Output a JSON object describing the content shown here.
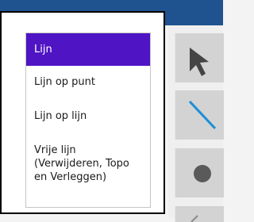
{
  "window": {
    "title_bar_color": "#1e5390"
  },
  "menu": {
    "items": [
      {
        "label": "Lijn",
        "selected": true
      },
      {
        "label": "Lijn op punt",
        "selected": false
      },
      {
        "label": "Lijn op lijn",
        "selected": false
      },
      {
        "label": "Vrije lijn\n(Verwijderen, Topo\nen Verleggen)",
        "selected": false
      }
    ],
    "selected_color": "#4f14c4"
  },
  "toolbar": {
    "tools": [
      {
        "icon": "arrow-pointer-icon"
      },
      {
        "icon": "line-tool-icon",
        "color": "#1a8fd6"
      },
      {
        "icon": "point-tool-icon",
        "color": "#5a5a5a"
      },
      {
        "icon": "partial-tool-icon"
      }
    ]
  }
}
